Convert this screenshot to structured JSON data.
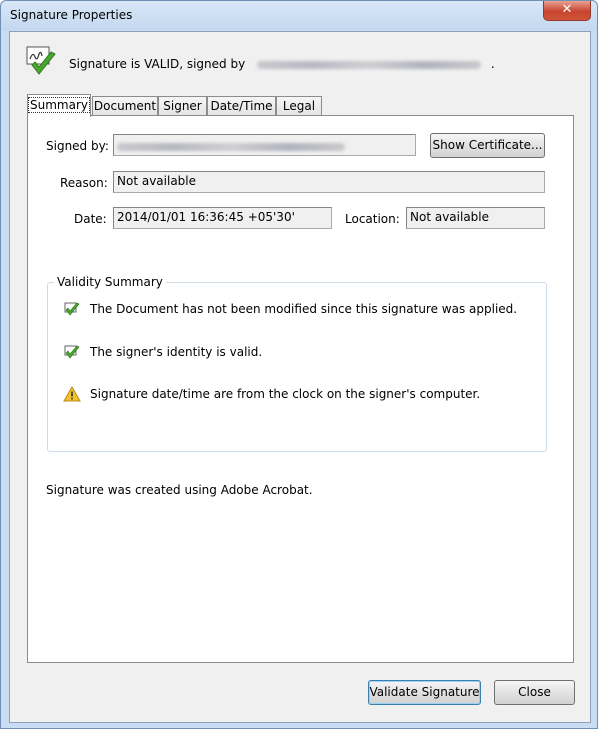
{
  "window": {
    "title": "Signature Properties",
    "close_glyph": "✕"
  },
  "header": {
    "status_prefix": "Signature is VALID, signed by",
    "status_suffix": ".",
    "icon": "signature-valid-icon"
  },
  "tabs": [
    {
      "label": "Summary",
      "active": true
    },
    {
      "label": "Document",
      "active": false
    },
    {
      "label": "Signer",
      "active": false
    },
    {
      "label": "Date/Time",
      "active": false
    },
    {
      "label": "Legal",
      "active": false
    }
  ],
  "summary": {
    "signed_by_label": "Signed by:",
    "show_certificate_label": "Show Certificate...",
    "reason_label": "Reason:",
    "reason_value": "Not available",
    "date_label": "Date:",
    "date_value": "2014/01/01 16:36:45 +05'30'",
    "location_label": "Location:",
    "location_value": "Not available",
    "validity_title": "Validity Summary",
    "validity_items": [
      {
        "icon": "valid-check-icon",
        "text": "The Document has not been modified since this signature was applied."
      },
      {
        "icon": "valid-check-icon",
        "text": "The signer's identity is valid."
      },
      {
        "icon": "warning-icon",
        "text": "Signature date/time are from the clock on the signer's computer."
      }
    ],
    "created_note": "Signature was created using Adobe Acrobat."
  },
  "footer": {
    "validate_label": "Validate Signature",
    "close_label": "Close"
  },
  "colors": {
    "accent_green": "#3a9a28",
    "warning_yellow": "#f2c12e"
  }
}
